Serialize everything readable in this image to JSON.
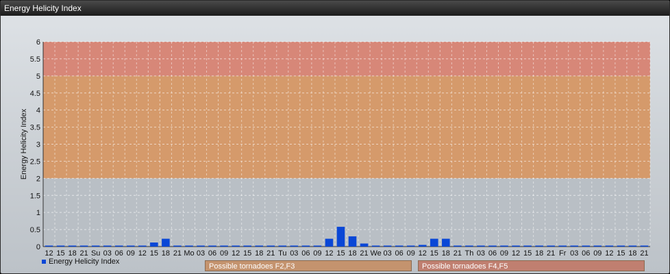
{
  "window": {
    "title": "Energy Helicity Index"
  },
  "chart_data": {
    "type": "bar",
    "title": "Energy Helicity Index",
    "ylabel": "Energy Helicity Index",
    "xlabel": "",
    "ylim": [
      0,
      6
    ],
    "yticks": [
      "0",
      "0.5",
      "1",
      "1.5",
      "2",
      "2.5",
      "3",
      "3.5",
      "4",
      "4.5",
      "5",
      "5.5",
      "6"
    ],
    "grid": true,
    "categories": [
      "12",
      "15",
      "18",
      "21",
      "Su",
      "03",
      "06",
      "09",
      "12",
      "15",
      "18",
      "21",
      "Mo",
      "03",
      "06",
      "09",
      "12",
      "15",
      "18",
      "21",
      "Tu",
      "03",
      "06",
      "09",
      "12",
      "15",
      "18",
      "21",
      "We",
      "03",
      "06",
      "09",
      "12",
      "15",
      "18",
      "21",
      "Th",
      "03",
      "06",
      "09",
      "12",
      "15",
      "18",
      "21",
      "Fr",
      "03",
      "06",
      "09",
      "12",
      "15",
      "18",
      "21"
    ],
    "series": [
      {
        "name": "Energy Helicity Index",
        "color": "#0a47d6",
        "values": [
          0.01,
          0.01,
          0.02,
          0.01,
          0.01,
          0.01,
          0.01,
          0.01,
          0.01,
          0.12,
          0.23,
          0.01,
          0.01,
          0.01,
          0.01,
          0.01,
          0.01,
          0.01,
          0.01,
          0.01,
          0.01,
          0.01,
          0.01,
          0.01,
          0.23,
          0.58,
          0.3,
          0.09,
          0.01,
          0.01,
          0.01,
          0.01,
          0.05,
          0.23,
          0.23,
          0.03,
          0.01,
          0.01,
          0.01,
          0.01,
          0.01,
          0.01,
          0.01,
          0.01,
          0.01,
          0.01,
          0.01,
          0.01,
          0.01,
          0.01,
          0.03,
          0.02
        ]
      }
    ],
    "bands": [
      {
        "from": 2,
        "to": 5,
        "color": "#d9935a",
        "label": "Possible tornadoes F2,F3"
      },
      {
        "from": 5,
        "to": 6,
        "color": "#dc7d6a",
        "label": "Possible tornadoes F4,F5"
      }
    ],
    "legend_position": "bottom-left"
  },
  "band_notes": [
    {
      "label": "Possible tornadoes F2,F3",
      "color": "#c4936e"
    },
    {
      "label": "Possible tornadoes F4,F5",
      "color": "#c07f70"
    }
  ]
}
